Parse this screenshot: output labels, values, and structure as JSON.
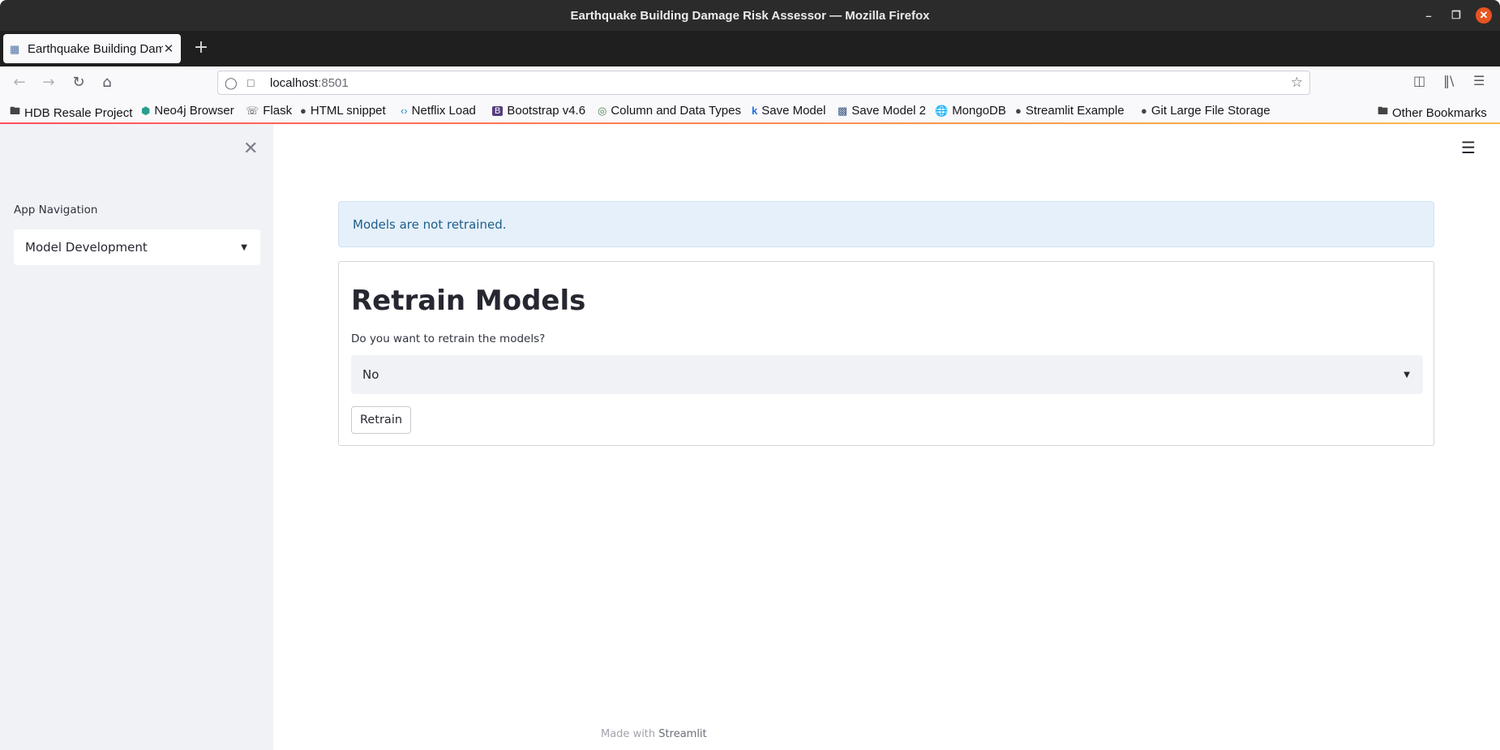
{
  "window": {
    "title": "Earthquake Building Damage Risk Assessor — Mozilla Firefox"
  },
  "tab": {
    "title": "Earthquake Building Dam"
  },
  "nav": {
    "url_host": "localhost",
    "url_port": ":8501"
  },
  "bookmarks": [
    {
      "label": "HDB Resale Project",
      "icon": "folder-icon"
    },
    {
      "label": "Neo4j Browser",
      "icon": "neo4j-icon"
    },
    {
      "label": "Flask",
      "icon": "flask-icon"
    },
    {
      "label": "HTML snippet",
      "icon": "github-icon"
    },
    {
      "label": "Netflix Load",
      "icon": "code-icon"
    },
    {
      "label": "Bootstrap v4.6",
      "icon": "bootstrap-icon"
    },
    {
      "label": "Column and Data Types",
      "icon": "target-icon"
    },
    {
      "label": "Save Model",
      "icon": "k-icon"
    },
    {
      "label": "Save Model 2",
      "icon": "image-icon"
    },
    {
      "label": "MongoDB",
      "icon": "globe-icon"
    },
    {
      "label": "Streamlit Example",
      "icon": "github-icon"
    },
    {
      "label": "Git Large File Storage",
      "icon": "github-icon"
    }
  ],
  "other_bookmarks": "Other Bookmarks",
  "sidebar": {
    "label": "App Navigation",
    "select_value": "Model Development"
  },
  "main": {
    "info": "Models are not retrained.",
    "title": "Retrain Models",
    "question": "Do you want to retrain the models?",
    "select_value": "No",
    "button": "Retrain"
  },
  "footer": {
    "prefix": "Made with ",
    "brand": "Streamlit"
  },
  "colors": {
    "accent": "#e95420",
    "info_bg": "#e6f0fa",
    "sidebar_bg": "#f0f2f6"
  }
}
